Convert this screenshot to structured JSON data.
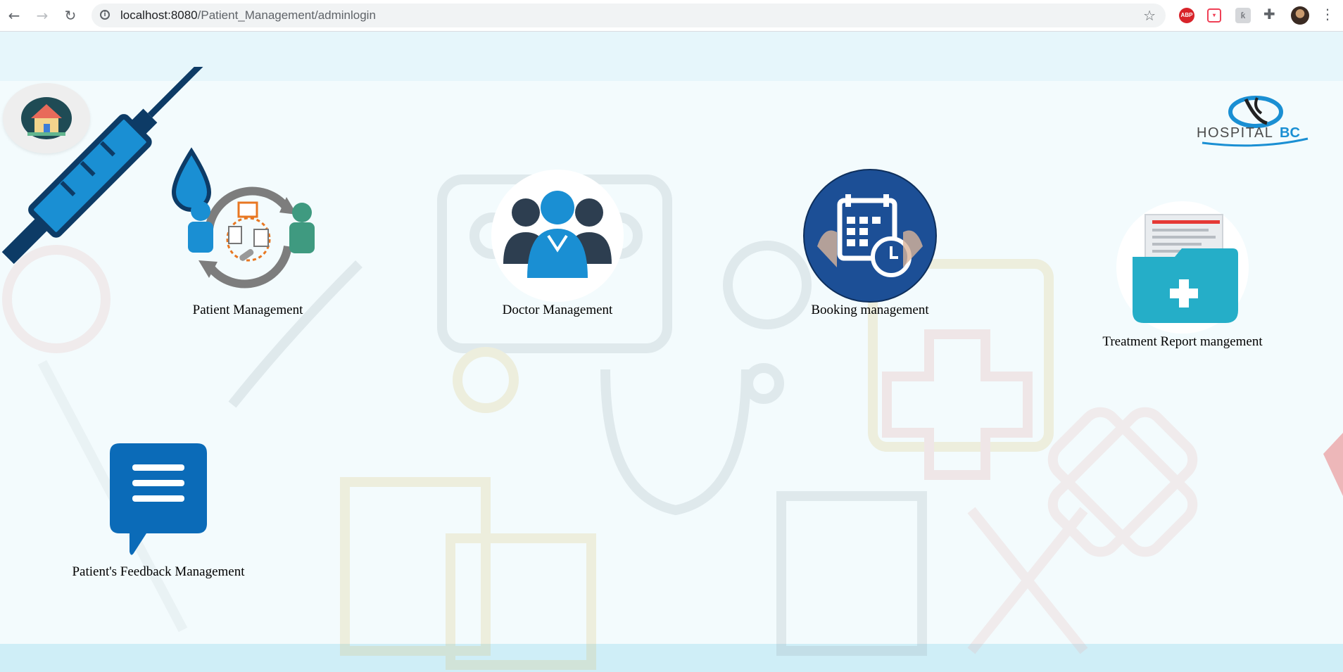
{
  "browser": {
    "url_host": "localhost:8080",
    "url_path": "/Patient_Management/adminlogin",
    "extensions": {
      "adblock_label": "ABP"
    }
  },
  "page": {
    "logo_text_main": "HOSPITAL",
    "logo_text_accent": "BC",
    "tiles": [
      {
        "label": "Patient Management"
      },
      {
        "label": "Doctor Management"
      },
      {
        "label": "Booking management"
      },
      {
        "label": "Treatment Report mangement"
      },
      {
        "label": "Patient's Feedback Management"
      }
    ]
  },
  "icons": {
    "back": "arrow-left-icon",
    "forward": "arrow-right-icon",
    "reload": "reload-icon",
    "info": "info-icon",
    "bookmark": "star-icon",
    "extensions": "puzzle-icon",
    "menu": "kebab-menu-icon",
    "home": "house-icon"
  },
  "colors": {
    "accent_blue": "#1a8fd3",
    "dark_blue": "#0b5aa5",
    "teal": "#25aec8",
    "page_bg": "#f3fbfd"
  }
}
